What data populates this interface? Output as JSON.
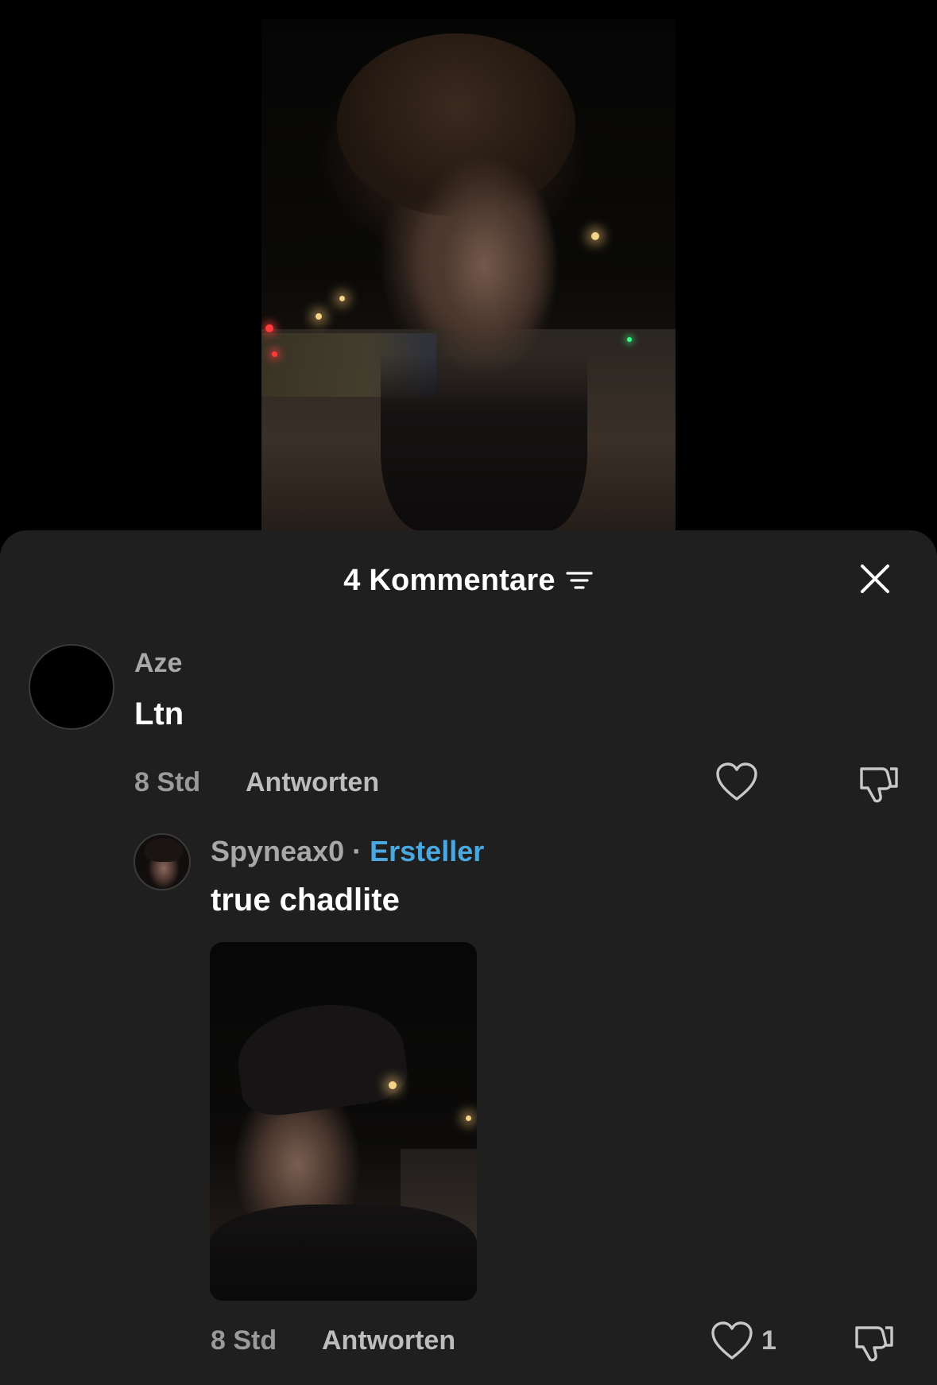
{
  "header": {
    "title": "4 Kommentare",
    "sort_icon": "sort-lines-icon",
    "close_icon": "close-icon"
  },
  "comments": [
    {
      "username": "Aze",
      "text": "Ltn",
      "time": "8 Std",
      "reply_label": "Antworten",
      "like_count": ""
    },
    {
      "username": "Spyneax0",
      "separator": "·",
      "badge": "Ersteller",
      "text": "true chadlite",
      "time": "8 Std",
      "reply_label": "Antworten",
      "like_count": "1"
    }
  ],
  "colors": {
    "sheet_bg": "#1f1f20",
    "creator_badge": "#4aa8e0",
    "username": "#a8a8a8"
  }
}
